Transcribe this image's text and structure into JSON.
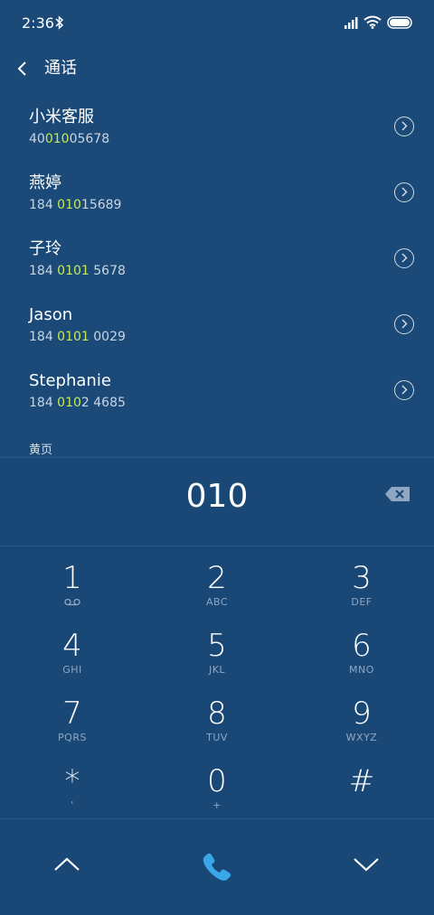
{
  "status_bar": {
    "time": "2:36",
    "icons": [
      "bluetooth-icon",
      "signal-icon",
      "wifi-icon",
      "battery-icon"
    ]
  },
  "header": {
    "title": "通话",
    "back_icon": "chevron-left-icon"
  },
  "contacts": [
    {
      "name": "小米客服",
      "number_before": "40",
      "number_match": "010",
      "number_after": "05678"
    },
    {
      "name": "燕婷",
      "number_before": "184 ",
      "number_match": "010",
      "number_after": "15689"
    },
    {
      "name": "子玲",
      "number_before": "184 ",
      "number_match": "0101",
      "number_after": " 5678"
    },
    {
      "name": "Jason",
      "number_before": "184 ",
      "number_match": "0101",
      "number_after": " 0029"
    },
    {
      "name": "Stephanie",
      "number_before": "184 ",
      "number_match": "010",
      "number_after": "2 4685"
    }
  ],
  "section_label": "黄页",
  "dialer": {
    "input_value": "010",
    "keys": [
      {
        "digit": "1",
        "letters": ""
      },
      {
        "digit": "2",
        "letters": "ABC"
      },
      {
        "digit": "3",
        "letters": "DEF"
      },
      {
        "digit": "4",
        "letters": "GHI"
      },
      {
        "digit": "5",
        "letters": "JKL"
      },
      {
        "digit": "6",
        "letters": "MNO"
      },
      {
        "digit": "7",
        "letters": "PQRS"
      },
      {
        "digit": "8",
        "letters": "TUV"
      },
      {
        "digit": "9",
        "letters": "WXYZ"
      },
      {
        "digit": "*",
        "letters": "'"
      },
      {
        "digit": "0",
        "letters": "+"
      },
      {
        "digit": "#",
        "letters": ""
      }
    ]
  },
  "colors": {
    "background": "#1b4a78",
    "highlight": "#c7e85a",
    "call": "#3aa8e8"
  }
}
